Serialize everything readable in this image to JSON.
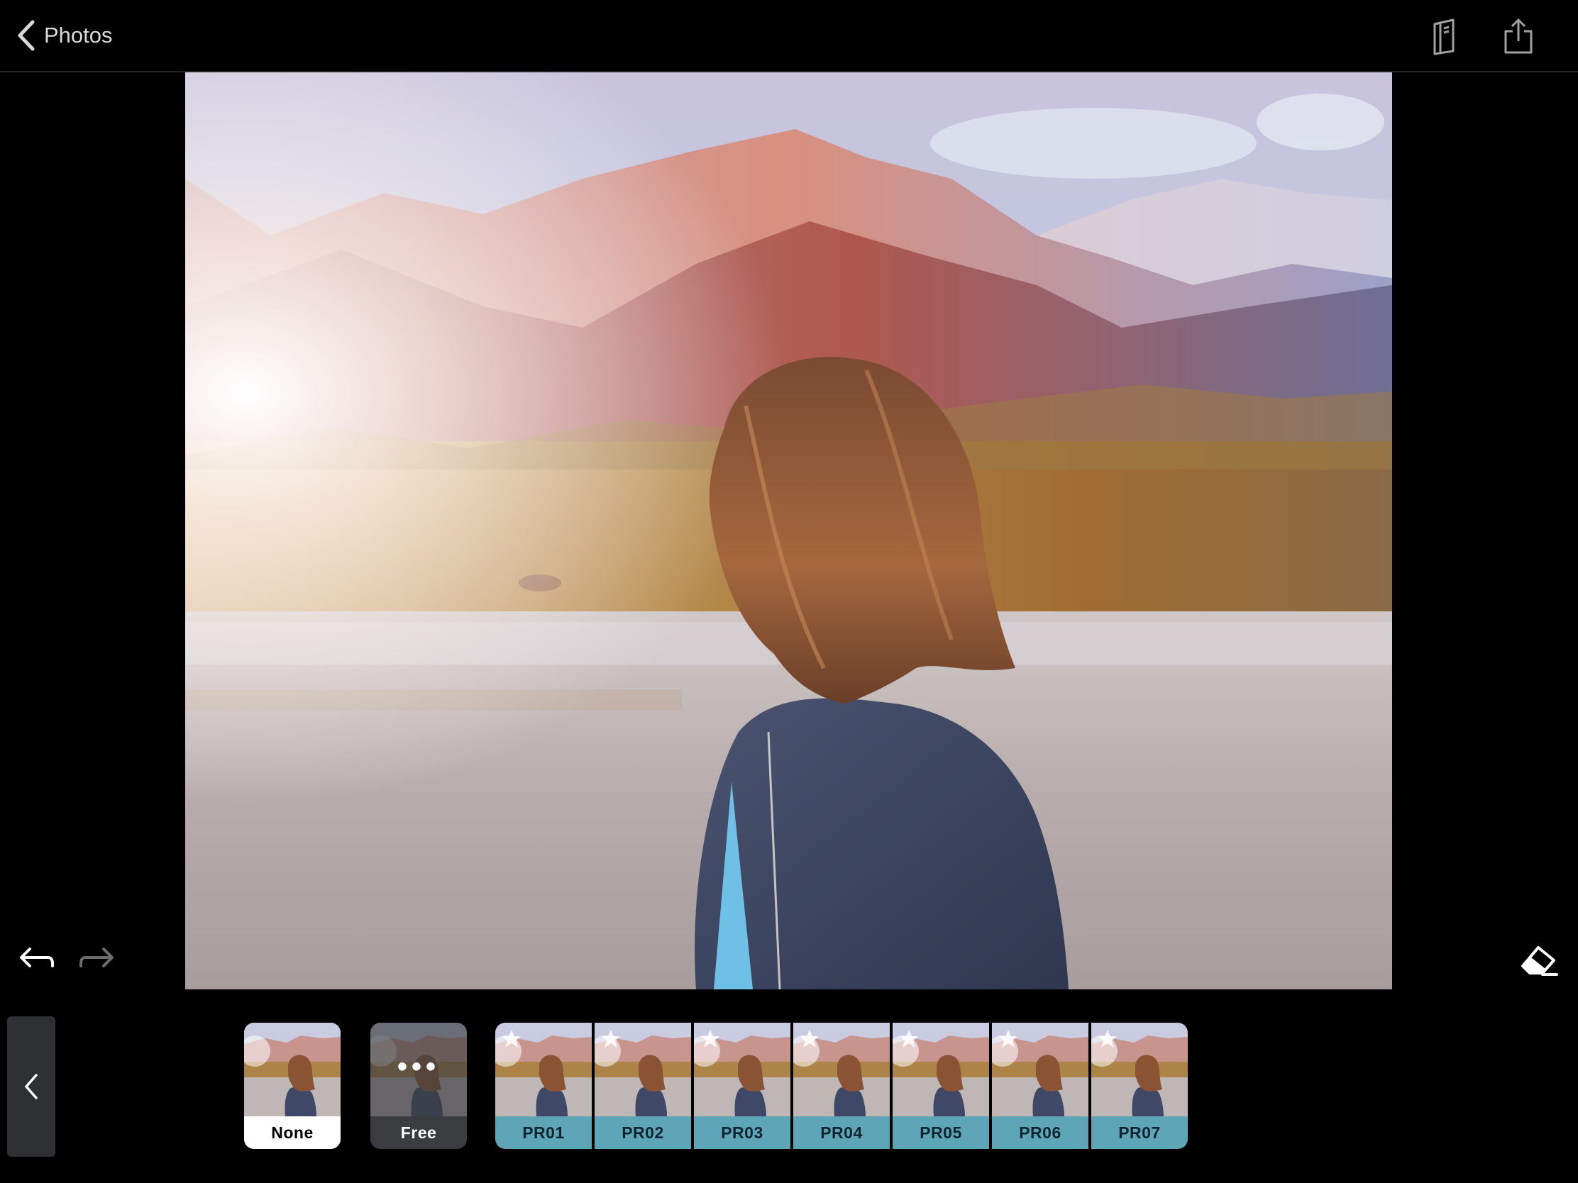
{
  "nav": {
    "back_label": "Photos",
    "book_icon": "book-icon",
    "share_icon": "share-icon"
  },
  "controls": {
    "undo_icon": "undo-icon",
    "redo_icon": "redo-icon",
    "eraser_icon": "eraser-icon"
  },
  "strip": {
    "collapse_icon": "chevron-left-icon"
  },
  "filters": {
    "none": "None",
    "free": "Free",
    "free_dots": "•••",
    "pro": [
      "PR01",
      "PR02",
      "PR03",
      "PR04",
      "PR05",
      "PR06",
      "PR07"
    ]
  },
  "colors": {
    "pro_accent": "#5fa5b8",
    "background": "#000000"
  }
}
